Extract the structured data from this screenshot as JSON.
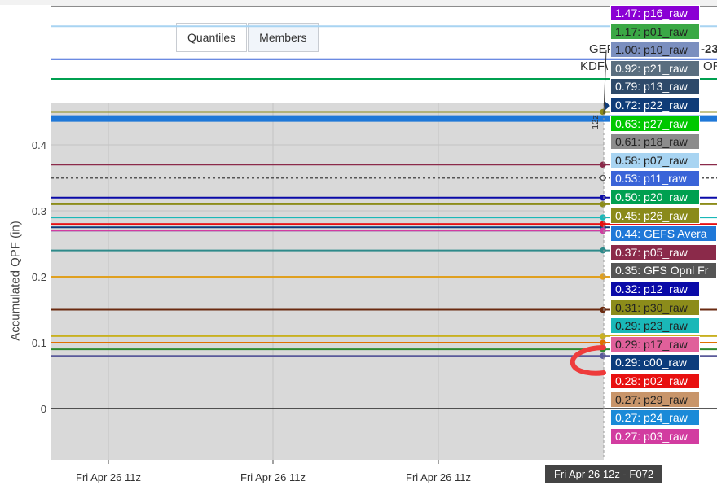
{
  "toolbar": {
    "quantiles_label": "Quantiles",
    "members_label": "Members"
  },
  "title_fragments": {
    "line1_left": "GEF",
    "line1_right": "-23",
    "line2_left": "KDF\\",
    "line2_right": "ORT"
  },
  "hover_x_label": "Fri Apr 26 12z - F072",
  "hover_tag_text": "12z",
  "chart_data": {
    "type": "line",
    "ylabel": "Accumulated QPF (in)",
    "ylim": [
      -0.075,
      0.46
    ],
    "y_ticks": [
      0,
      0.1,
      0.2,
      0.3,
      0.4
    ],
    "y_tick_labels": [
      "0",
      "0.1",
      "0.2",
      "0.3",
      "0.4"
    ],
    "x_tick_labels": [
      "Fri Apr 26 11z",
      "Fri Apr 26 11z",
      "Fri Apr 26 11z"
    ],
    "grid": true,
    "series": [
      {
        "name": "GEFS Average",
        "value": 0.44,
        "color": "#1f78d8",
        "wide": true
      },
      {
        "name": "p16_raw",
        "value": 1.47,
        "color": "#8a00d4"
      },
      {
        "name": "p01_raw",
        "value": 1.17,
        "color": "#3aa845"
      },
      {
        "name": "p10_raw",
        "value": 1.0,
        "color": "#7b8fbf"
      },
      {
        "name": "p21_raw",
        "value": 0.92,
        "color": "#5a6e7f"
      },
      {
        "name": "p13_raw",
        "value": 0.79,
        "color": "#2e4a6a"
      },
      {
        "name": "p22_raw",
        "value": 0.72,
        "color": "#0f3c78"
      },
      {
        "name": "p27_raw",
        "value": 0.63,
        "color": "#00c800"
      },
      {
        "name": "p18_raw",
        "value": 0.61,
        "color": "#8c8c8c"
      },
      {
        "name": "p07_raw",
        "value": 0.58,
        "color": "#a8d4f2"
      },
      {
        "name": "p11_raw",
        "value": 0.53,
        "color": "#3a64d8"
      },
      {
        "name": "p20_raw",
        "value": 0.5,
        "color": "#00a050"
      },
      {
        "name": "p26_raw",
        "value": 0.45,
        "color": "#8a8a1a",
        "dot": true
      },
      {
        "name": "p05_raw",
        "value": 0.37,
        "color": "#8b2a4a",
        "dot": true
      },
      {
        "name": "GFS Opnl",
        "value": 0.35,
        "color": "#555555",
        "dashed": true,
        "hollow": true
      },
      {
        "name": "p12_raw",
        "value": 0.32,
        "color": "#0a0aa8",
        "dot": true
      },
      {
        "name": "p30_raw",
        "value": 0.31,
        "color": "#8c8c1a",
        "dot": true
      },
      {
        "name": "p23_raw",
        "value": 0.29,
        "color": "#1ab8b8",
        "dot": true
      },
      {
        "name": "p17_raw",
        "value": 0.28,
        "color": "#e0609a",
        "dot": true
      },
      {
        "name": "c00_raw",
        "value": 0.275,
        "color": "#0c3c7c",
        "dot": true
      },
      {
        "name": "p02_raw",
        "value": 0.28,
        "color": "#e81010",
        "dot": true
      },
      {
        "name": "p29_raw",
        "value": 0.27,
        "color": "#c8956a",
        "dot": true
      },
      {
        "name": "p24_raw",
        "value": 0.27,
        "color": "#1a8ad8",
        "dot": true
      },
      {
        "name": "p03_raw",
        "value": 0.27,
        "color": "#d23ca0",
        "dot": true
      },
      {
        "name": "",
        "value": 0.24,
        "color": "#2e8a8a",
        "dot": true
      },
      {
        "name": "",
        "value": 0.2,
        "color": "#e0a020",
        "dot": true
      },
      {
        "name": "",
        "value": 0.15,
        "color": "#6a2a10",
        "dot": true
      },
      {
        "name": "",
        "value": 0.11,
        "color": "#c8b020",
        "dot": true
      },
      {
        "name": "",
        "value": 0.1,
        "color": "#e07000",
        "dot": true
      },
      {
        "name": "",
        "value": 0.09,
        "color": "#2e8a30",
        "dot": true
      },
      {
        "name": "",
        "value": 0.08,
        "color": "#5a5a9a",
        "dot": true
      }
    ],
    "hover_labels": [
      {
        "text": "1.47: p16_raw",
        "bg": "#8a00d4",
        "fg": "#ffffff"
      },
      {
        "text": "1.17: p01_raw",
        "bg": "#3aa845",
        "fg": "#222222"
      },
      {
        "text": "1.00: p10_raw",
        "bg": "#7b8fbf",
        "fg": "#222222"
      },
      {
        "text": "0.92: p21_raw",
        "bg": "#5a6e7f",
        "fg": "#ffffff"
      },
      {
        "text": "0.79: p13_raw",
        "bg": "#2e4a6a",
        "fg": "#ffffff"
      },
      {
        "text": "0.72: p22_raw",
        "bg": "#0f3c78",
        "fg": "#ffffff"
      },
      {
        "text": "0.63: p27_raw",
        "bg": "#00c800",
        "fg": "#ffffff"
      },
      {
        "text": "0.61: p18_raw",
        "bg": "#8c8c8c",
        "fg": "#222222"
      },
      {
        "text": "0.58: p07_raw",
        "bg": "#a8d4f2",
        "fg": "#222222"
      },
      {
        "text": "0.53: p11_raw",
        "bg": "#3a64d8",
        "fg": "#ffffff"
      },
      {
        "text": "0.50: p20_raw",
        "bg": "#00a050",
        "fg": "#ffffff"
      },
      {
        "text": "0.45: p26_raw",
        "bg": "#8a8a1a",
        "fg": "#ffffff"
      },
      {
        "text": "0.44: GEFS Avera",
        "bg": "#1f78d8",
        "fg": "#ffffff"
      },
      {
        "text": "0.37: p05_raw",
        "bg": "#8b2a4a",
        "fg": "#ffffff"
      },
      {
        "text": "0.35: GFS Opnl Fr",
        "bg": "#555555",
        "fg": "#ffffff"
      },
      {
        "text": "0.32: p12_raw",
        "bg": "#0a0aa8",
        "fg": "#ffffff"
      },
      {
        "text": "0.31: p30_raw",
        "bg": "#8c8c1a",
        "fg": "#222222"
      },
      {
        "text": "0.29: p23_raw",
        "bg": "#1ab8b8",
        "fg": "#222222"
      },
      {
        "text": "0.29: p17_raw",
        "bg": "#e0609a",
        "fg": "#222222"
      },
      {
        "text": "0.29: c00_raw",
        "bg": "#0c3c7c",
        "fg": "#ffffff"
      },
      {
        "text": "0.28: p02_raw",
        "bg": "#e81010",
        "fg": "#ffffff"
      },
      {
        "text": "0.27: p29_raw",
        "bg": "#c8956a",
        "fg": "#222222"
      },
      {
        "text": "0.27: p24_raw",
        "bg": "#1a8ad8",
        "fg": "#ffffff"
      },
      {
        "text": "0.27: p03_raw",
        "bg": "#d23ca0",
        "fg": "#ffffff"
      }
    ]
  },
  "annotation": {
    "color": "#ee3b3b"
  }
}
